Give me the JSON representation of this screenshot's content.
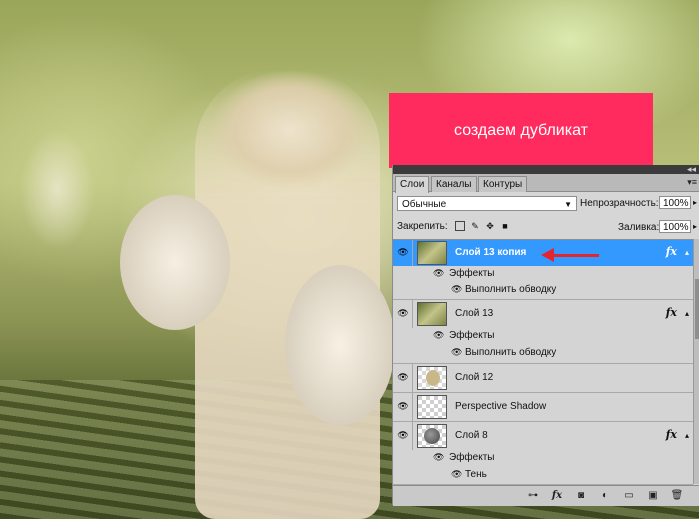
{
  "banner": {
    "text": "создаем дубликат"
  },
  "panel": {
    "tabs": [
      "Слои",
      "Каналы",
      "Контуры"
    ],
    "active_tab": 0,
    "blend_mode": "Обычные",
    "opacity_label": "Непрозрачность:",
    "opacity_value": "100%",
    "lock_label": "Закрепить:",
    "fill_label": "Заливка:",
    "fill_value": "100%",
    "layers": [
      {
        "name": "Слой 13 копия",
        "selected": true,
        "fx": "fx",
        "thumb": "photo",
        "effects_label": "Эффекты",
        "effect": "Выполнить обводку"
      },
      {
        "name": "Слой 13",
        "selected": false,
        "fx": "fx",
        "thumb": "photo",
        "effects_label": "Эффекты",
        "effect": "Выполнить обводку"
      },
      {
        "name": "Слой 12",
        "selected": false,
        "thumb": "hen"
      },
      {
        "name": "Perspective Shadow",
        "selected": false,
        "thumb": "check"
      },
      {
        "name": "Слой 8",
        "selected": false,
        "fx": "fx",
        "thumb": "sphere",
        "effects_label": "Эффекты",
        "effect": "Тень"
      }
    ],
    "bottom_icons": [
      "link-icon",
      "fx-icon",
      "mask-icon",
      "adjustment-icon",
      "group-icon",
      "new-layer-icon",
      "trash-icon"
    ]
  }
}
